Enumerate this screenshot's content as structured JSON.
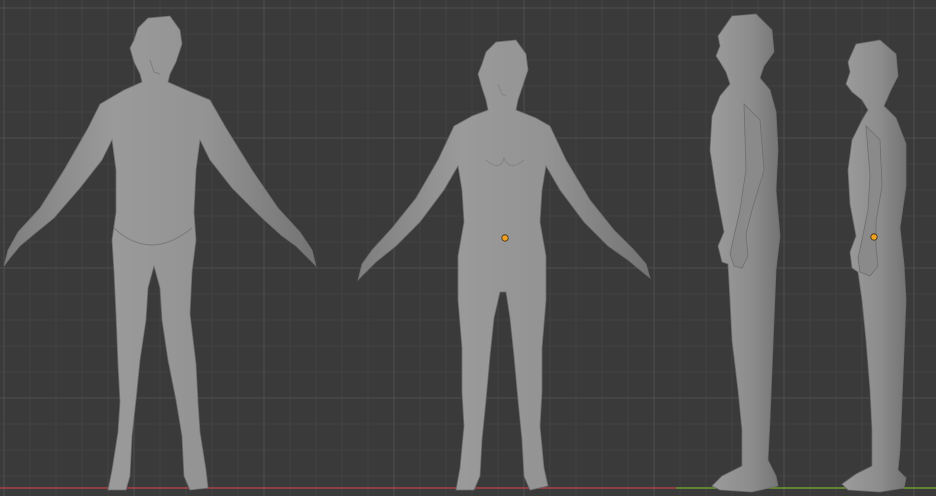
{
  "viewport": {
    "background_color": "#3a3a3a",
    "grid_minor_color": "#434343",
    "grid_major_color": "#4f4f4f",
    "x_axis_color": "#a8424b",
    "y_axis_color": "#6f9c2f",
    "mesh_color": "#8f8f8f",
    "mesh_shadow_color": "#6c6c6c",
    "mesh_highlight_color": "#a4a4a4",
    "object_origin_color": "#f0a020"
  },
  "models": [
    {
      "name": "male-front",
      "view": "front",
      "selected": false
    },
    {
      "name": "female-front",
      "view": "front",
      "selected": true
    },
    {
      "name": "male-side",
      "view": "side",
      "selected": false
    },
    {
      "name": "female-side",
      "view": "side",
      "selected": true
    }
  ]
}
